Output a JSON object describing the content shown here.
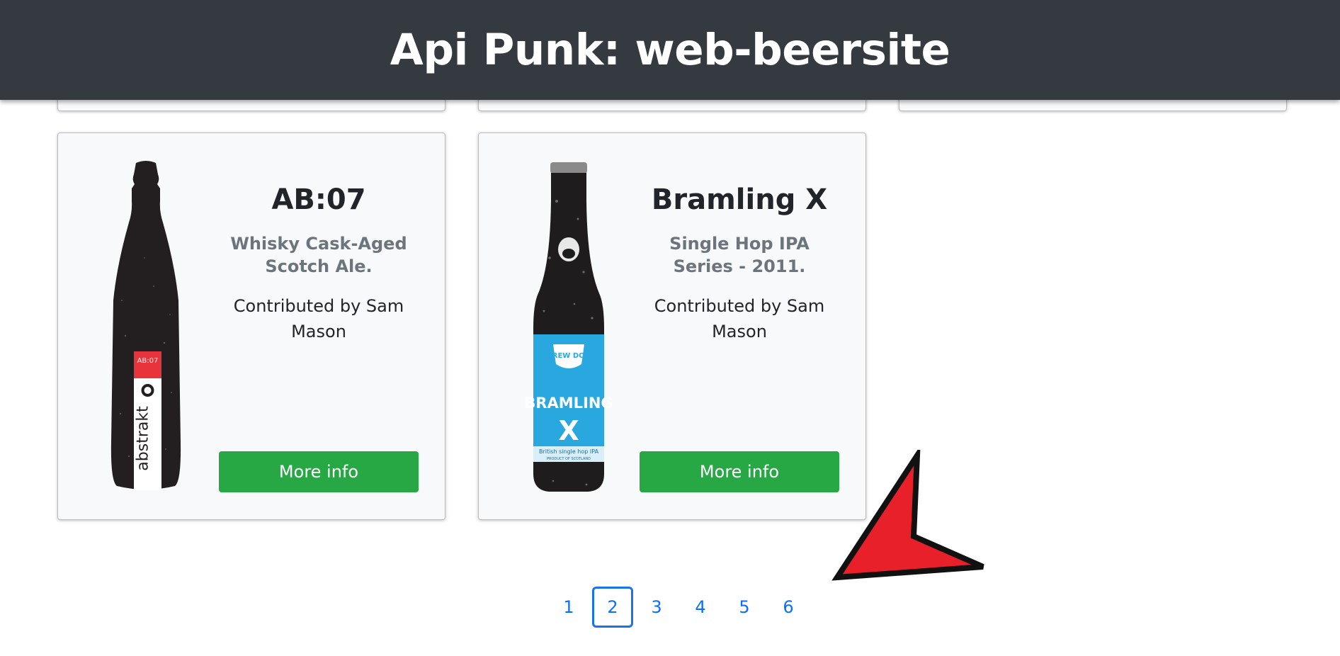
{
  "header": {
    "title": "Api Punk: web-beersite"
  },
  "beers": [
    {
      "name": "AB:07",
      "tagline": "Whisky Cask-Aged Scotch Ale.",
      "contributed": "Contributed by Sam Mason",
      "button": "More info",
      "bottle_label": "AB:07",
      "bottle_brand": "abstrakt"
    },
    {
      "name": "Bramling X",
      "tagline": "Single Hop IPA Series - 2011.",
      "contributed": "Contributed by Sam Mason",
      "button": "More info",
      "bottle_brand": "BRAMLING",
      "bottle_brand_sub": "X",
      "bottle_logo": "BREW DOG",
      "bottle_small": "British single hop IPA",
      "bottle_foot": "PRODUCT OF SCOTLAND"
    }
  ],
  "pagination": {
    "pages": [
      "1",
      "2",
      "3",
      "4",
      "5",
      "6"
    ],
    "current": "2"
  },
  "colors": {
    "header_bg": "#343a40",
    "button_green": "#28a745",
    "link_blue": "#0d6efd",
    "cursor_red": "#e8202a"
  }
}
